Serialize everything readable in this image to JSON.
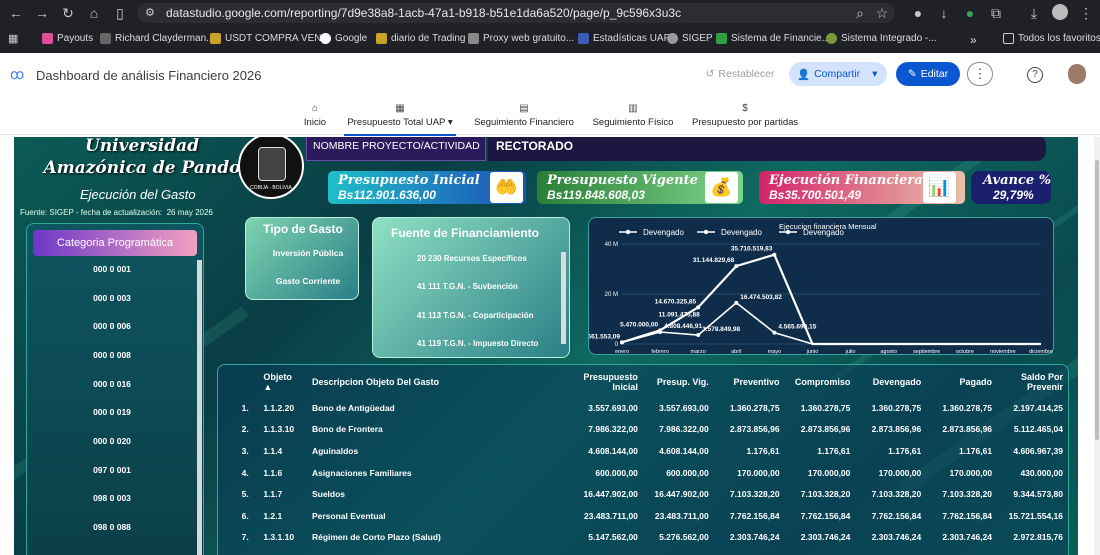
{
  "browser": {
    "url": "datastudio.google.com/reporting/7d9e38a8-1acb-47a1-b918-b51e1da6a520/page/p_9c596x3u3c",
    "bookmarks": [
      "Payouts",
      "Richard Clayderman...",
      "USDT COMPRA VEN...",
      "Google",
      "diario de Trading",
      "Proxy web gratuito...",
      "Estadísticas UAP",
      "SIGEP",
      "Sistema de Financie...",
      "Sistema Integrado -..."
    ],
    "bookmarks_overflow": "»",
    "all_bookmarks": "Todos los favoritos"
  },
  "app": {
    "title": "Dashboard de análisis Financiero 2026",
    "reset_label": "Restablecer",
    "share_label": "Compartir",
    "edit_label": "Editar"
  },
  "tabs": [
    {
      "label": "Inicio",
      "icon": "home-icon"
    },
    {
      "label": "Presupuesto Total UAP",
      "icon": "table-icon"
    },
    {
      "label": "Seguimiento Financiero",
      "icon": "chart-icon"
    },
    {
      "label": "Seguimiento Físico",
      "icon": "bar-chart-icon"
    },
    {
      "label": "Presupuesto por partidas",
      "icon": "money-icon"
    }
  ],
  "tab_dropdown": "▾",
  "report": {
    "university": "Universidad Amazónica de Pando",
    "subtitle": "Ejecución del Gasto",
    "source": "Fuente: SIGEP - fecha de actualización:",
    "update_date": "26 may 2026",
    "project_label": "NOMBRE PROYECTO/ACTIVIDAD",
    "project_value": "RECTORADO",
    "seal_text": "COBIJA - BOLIVIA",
    "kpis": [
      {
        "title": "Presupuesto Inicial",
        "value": "Bs112.901.636,00",
        "icon": "money-hand-icon"
      },
      {
        "title": "Presupuesto Vigente",
        "value": "Bs119.848.608,03",
        "icon": "money-bag-icon"
      },
      {
        "title": "Ejecución Financiera",
        "value": "Bs35.700.501,49",
        "icon": "analytics-icon"
      },
      {
        "title": "Avance %",
        "value": "29,79%"
      }
    ],
    "category": {
      "header": "Categoria Programática",
      "items": [
        "000 0 001",
        "000 0 003",
        "000 0 006",
        "000 0 008",
        "000 0 016",
        "000 0 019",
        "000 0 020",
        "097 0 001",
        "098 0 003",
        "098 0 088"
      ]
    },
    "tipo_gasto": {
      "header": "Tipo de Gasto",
      "items": [
        "Inversión Pública",
        "Gasto Corriente"
      ]
    },
    "fuente": {
      "header": "Fuente de Financiamiento",
      "items": [
        "20 230 Recursos Específicos",
        "41 111 T.G.N. - Suvbención",
        "41 113 T.G.N. - Coparticipación",
        "41 119 T.G.N. - Impuesto Directo"
      ]
    },
    "table": {
      "headers": [
        "Objeto",
        "Descripcion Objeto Del Gasto",
        "Presupuesto Inicial",
        "Presup. Vig.",
        "Preventivo",
        "Compromiso",
        "Devengado",
        "Pagado",
        "Saldo Por Prevenir"
      ],
      "sort_indicator": "▲",
      "rows": [
        [
          "1.",
          "1.1.2.20",
          "Bono de Antigüedad",
          "3.557.693,00",
          "3.557.693,00",
          "1.360.278,75",
          "1.360.278,75",
          "1.360.278,75",
          "1.360.278,75",
          "2.197.414,25"
        ],
        [
          "2.",
          "1.1.3.10",
          "Bono de Frontera",
          "7.986.322,00",
          "7.986.322,00",
          "2.873.856,96",
          "2.873.856,96",
          "2.873.856,96",
          "2.873.856,96",
          "5.112.465,04"
        ],
        [
          "3.",
          "1.1.4",
          "Aguinaldos",
          "4.608.144,00",
          "4.608.144,00",
          "1.176,61",
          "1.176,61",
          "1.176,61",
          "1.176,61",
          "4.606.967,39"
        ],
        [
          "4.",
          "1.1.6",
          "Asignaciones Familiares",
          "600.000,00",
          "600.000,00",
          "170.000,00",
          "170.000,00",
          "170.000,00",
          "170.000,00",
          "430.000,00"
        ],
        [
          "5.",
          "1.1.7",
          "Sueldos",
          "16.447.902,00",
          "16.447.902,00",
          "7.103.328,20",
          "7.103.328,20",
          "7.103.328,20",
          "7.103.328,20",
          "9.344.573,80"
        ],
        [
          "6.",
          "1.2.1",
          "Personal Eventual",
          "23.483.711,00",
          "23.483.711,00",
          "7.762.156,84",
          "7.762.156,84",
          "7.762.156,84",
          "7.762.156,84",
          "15.721.554,16"
        ],
        [
          "7.",
          "1.3.1.10",
          "Régimen de Corto Plazo (Salud)",
          "5.147.562,00",
          "5.276.562,00",
          "2.303.746,24",
          "2.303.746,24",
          "2.303.746,24",
          "2.303.746,24",
          "2.972.815,76"
        ]
      ]
    }
  },
  "chart_data": {
    "type": "line",
    "title": "Ejecucion financiera Mensual",
    "xlabel": "mes",
    "ylabel": "",
    "categories": [
      "enero",
      "febrero",
      "marzo",
      "abril",
      "mayo",
      "junio",
      "julio",
      "agosto",
      "septiembre",
      "octubre",
      "noviembre",
      "diciembre"
    ],
    "yticks": [
      "0",
      "20 M",
      "40 M"
    ],
    "ylim": [
      0,
      40000000
    ],
    "legend": [
      "Devengado",
      "Devengado",
      "Devengado"
    ],
    "series": [
      {
        "name": "Devengado",
        "values": [
          661553.09,
          5470000,
          14670325.85,
          31144829.68,
          35710519.83,
          0,
          0,
          0,
          0,
          0,
          0,
          0
        ],
        "labels": [
          "661.553,09",
          "5.470.000,00",
          "14.670.325,85",
          "31.144.829,68",
          "35.710.519,83",
          "",
          "",
          "",
          "",
          "",
          "",
          ""
        ]
      },
      {
        "name": "Devengado",
        "values": [
          661553.09,
          4808446.91,
          3578849.98,
          16474503.82,
          4565690.15,
          0,
          0,
          0,
          0,
          0,
          0,
          0
        ],
        "labels": [
          "",
          "4.808.446,91",
          "3.578.849,98",
          "16.474.503,82",
          "4.565.690,15",
          "",
          "",
          "",
          "",
          "",
          "",
          ""
        ]
      }
    ],
    "extra_labels": [
      "11.091.475,88"
    ],
    "colors": {
      "line": "#ffffff",
      "grid": "#3a6f8f"
    }
  }
}
